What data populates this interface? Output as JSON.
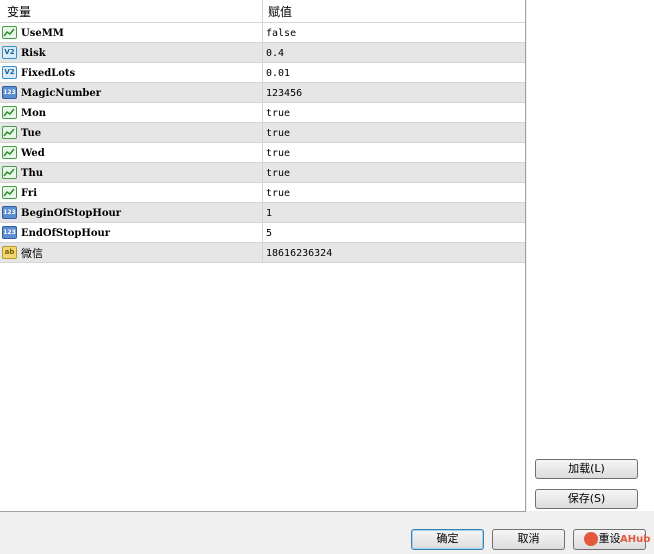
{
  "header": {
    "col_variable": "变量",
    "col_value": "赋值"
  },
  "rows": [
    {
      "icon": "bool-icon",
      "icon_text": "",
      "name": "UseMM",
      "value": "false"
    },
    {
      "icon": "double-icon",
      "icon_text": "V2",
      "name": "Risk",
      "value": "0.4"
    },
    {
      "icon": "double-icon",
      "icon_text": "V2",
      "name": "FixedLots",
      "value": "0.01"
    },
    {
      "icon": "int-icon",
      "icon_text": "123",
      "name": "MagicNumber",
      "value": "123456"
    },
    {
      "icon": "bool-icon",
      "icon_text": "",
      "name": "Mon",
      "value": "true"
    },
    {
      "icon": "bool-icon",
      "icon_text": "",
      "name": "Tue",
      "value": "true"
    },
    {
      "icon": "bool-icon",
      "icon_text": "",
      "name": "Wed",
      "value": "true"
    },
    {
      "icon": "bool-icon",
      "icon_text": "",
      "name": "Thu",
      "value": "true"
    },
    {
      "icon": "bool-icon",
      "icon_text": "",
      "name": "Fri",
      "value": "true"
    },
    {
      "icon": "int-icon",
      "icon_text": "123",
      "name": "BeginOfStopHour",
      "value": "1"
    },
    {
      "icon": "int-icon",
      "icon_text": "123",
      "name": "EndOfStopHour",
      "value": "5"
    },
    {
      "icon": "string-icon",
      "icon_text": "ab",
      "name": "微信",
      "value": "18616236324"
    }
  ],
  "side_buttons": {
    "load": "加载(L)",
    "save": "保存(S)"
  },
  "footer_buttons": {
    "ok": "确定",
    "cancel": "取消",
    "reset": "重设"
  },
  "watermark": "AHub",
  "colors": {
    "row_alt": "#e6e6e6",
    "grid_line": "#d5d5d5",
    "bool_icon": "#4a9a4a",
    "int_icon": "#5e8fd0",
    "string_icon": "#f2d873"
  }
}
